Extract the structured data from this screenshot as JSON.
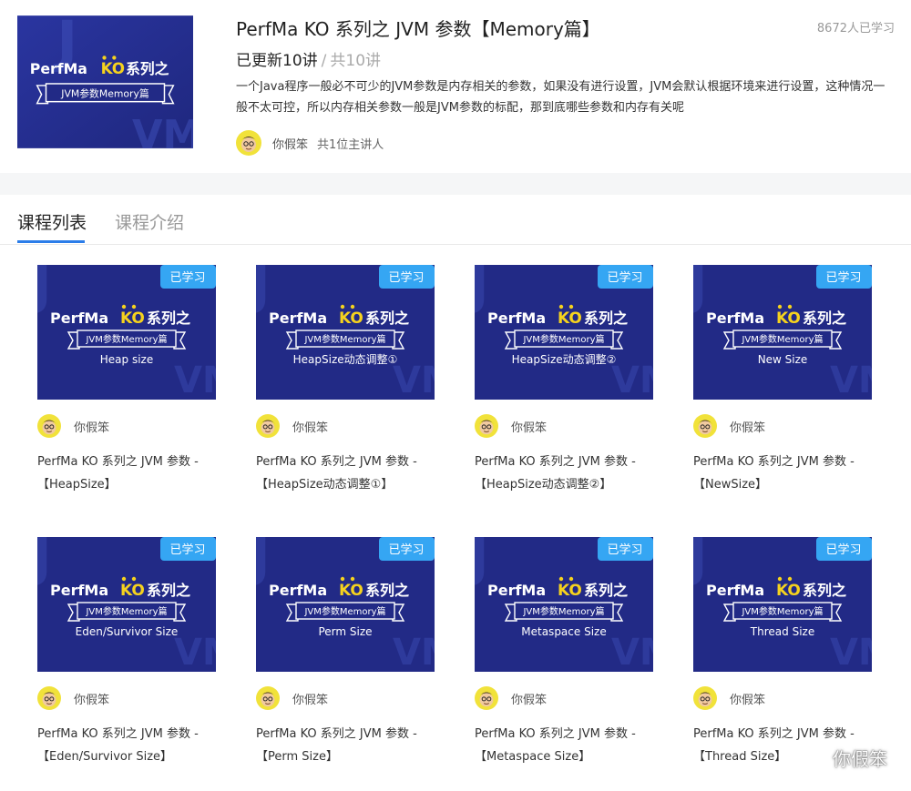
{
  "colors": {
    "cover_bg": "#222a86",
    "cover_bg_light": "#2c3a9c",
    "accent_yellow": "#f5d21e",
    "badge_blue": "#35a6f3",
    "tab_active": "#2b7de9"
  },
  "course": {
    "cover": {
      "brand_left": "PerfMa",
      "brand_ko": "KO",
      "brand_right": "系列之",
      "ribbon": "JVM参数Memory篇"
    },
    "title": "PerfMa KO 系列之 JVM 参数【Memory篇】",
    "learners": "8672人已学习",
    "updated": "已更新10讲",
    "separator": "/",
    "total": "共10讲",
    "description": "一个Java程序一般必不可少的JVM参数是内存相关的参数，如果没有进行设置，JVM会默认根据环境来进行设置，这种情况一般不太可控，所以内存相关参数一般是JVM参数的标配，那到底哪些参数和内存有关呢",
    "host_name": "你假笨",
    "host_count": "共1位主讲人"
  },
  "tabs": [
    {
      "label": "课程列表",
      "active": true
    },
    {
      "label": "课程介绍",
      "active": false
    }
  ],
  "lessons": [
    {
      "badge": "已学习",
      "brand_left": "PerfMa",
      "brand_ko": "KO",
      "brand_right": "系列之",
      "ribbon": "JVM参数Memory篇",
      "subtitle": "Heap size",
      "author": "你假笨",
      "title_line1": "PerfMa KO 系列之 JVM 参数 -",
      "title_line2": "【HeapSize】"
    },
    {
      "badge": "已学习",
      "brand_left": "PerfMa",
      "brand_ko": "KO",
      "brand_right": "系列之",
      "ribbon": "JVM参数Memory篇",
      "subtitle": "HeapSize动态调整①",
      "author": "你假笨",
      "title_line1": "PerfMa KO 系列之 JVM 参数 -",
      "title_line2": "【HeapSize动态调整①】"
    },
    {
      "badge": "已学习",
      "brand_left": "PerfMa",
      "brand_ko": "KO",
      "brand_right": "系列之",
      "ribbon": "JVM参数Memory篇",
      "subtitle": "HeapSize动态调整②",
      "author": "你假笨",
      "title_line1": "PerfMa KO 系列之 JVM 参数 -",
      "title_line2": "【HeapSize动态调整②】"
    },
    {
      "badge": "已学习",
      "brand_left": "PerfMa",
      "brand_ko": "KO",
      "brand_right": "系列之",
      "ribbon": "JVM参数Memory篇",
      "subtitle": "New Size",
      "author": "你假笨",
      "title_line1": "PerfMa KO 系列之 JVM 参数 -",
      "title_line2": "【NewSize】"
    },
    {
      "badge": "已学习",
      "brand_left": "PerfMa",
      "brand_ko": "KO",
      "brand_right": "系列之",
      "ribbon": "JVM参数Memory篇",
      "subtitle": "Eden/Survivor Size",
      "author": "你假笨",
      "title_line1": "PerfMa KO 系列之 JVM 参数 -",
      "title_line2": "【Eden/Survivor Size】"
    },
    {
      "badge": "已学习",
      "brand_left": "PerfMa",
      "brand_ko": "KO",
      "brand_right": "系列之",
      "ribbon": "JVM参数Memory篇",
      "subtitle": "Perm Size",
      "author": "你假笨",
      "title_line1": "PerfMa KO 系列之 JVM 参数 -",
      "title_line2": "【Perm Size】"
    },
    {
      "badge": "已学习",
      "brand_left": "PerfMa",
      "brand_ko": "KO",
      "brand_right": "系列之",
      "ribbon": "JVM参数Memory篇",
      "subtitle": "Metaspace Size",
      "author": "你假笨",
      "title_line1": "PerfMa KO 系列之 JVM 参数 -",
      "title_line2": "【Metaspace Size】"
    },
    {
      "badge": "已学习",
      "brand_left": "PerfMa",
      "brand_ko": "KO",
      "brand_right": "系列之",
      "ribbon": "JVM参数Memory篇",
      "subtitle": "Thread Size",
      "author": "你假笨",
      "title_line1": "PerfMa KO 系列之 JVM 参数 -",
      "title_line2": "【Thread Size】"
    }
  ],
  "watermark": {
    "icon": "wechat-icon",
    "text": "你假笨"
  }
}
